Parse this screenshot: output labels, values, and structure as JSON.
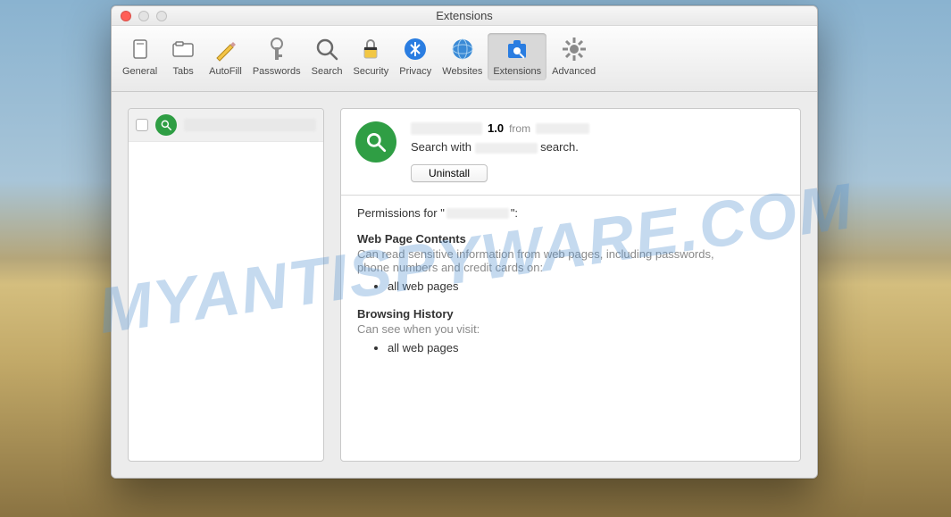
{
  "window": {
    "title": "Extensions"
  },
  "toolbar": {
    "items": [
      {
        "label": "General"
      },
      {
        "label": "Tabs"
      },
      {
        "label": "AutoFill"
      },
      {
        "label": "Passwords"
      },
      {
        "label": "Search"
      },
      {
        "label": "Security"
      },
      {
        "label": "Privacy"
      },
      {
        "label": "Websites"
      },
      {
        "label": "Extensions"
      },
      {
        "label": "Advanced"
      }
    ],
    "selected_index": 8
  },
  "sidebar": {
    "extensions": [
      {
        "name_redacted": true,
        "enabled": false
      }
    ]
  },
  "detail": {
    "name_redacted": true,
    "version": "1.0",
    "from_label": "from",
    "vendor_redacted": true,
    "description_prefix": "Search with",
    "description_mid_redacted": true,
    "description_suffix": "search.",
    "uninstall_label": "Uninstall",
    "permissions_label_prefix": "Permissions for \"",
    "permissions_label_suffix": "\":",
    "permissions": [
      {
        "heading": "Web Page Contents",
        "description": "Can read sensitive information from web pages, including passwords, phone numbers and credit cards on:",
        "items": [
          "all web pages"
        ]
      },
      {
        "heading": "Browsing History",
        "description": "Can see when you visit:",
        "items": [
          "all web pages"
        ]
      }
    ]
  },
  "watermark": "MYANTISPYWARE.COM"
}
